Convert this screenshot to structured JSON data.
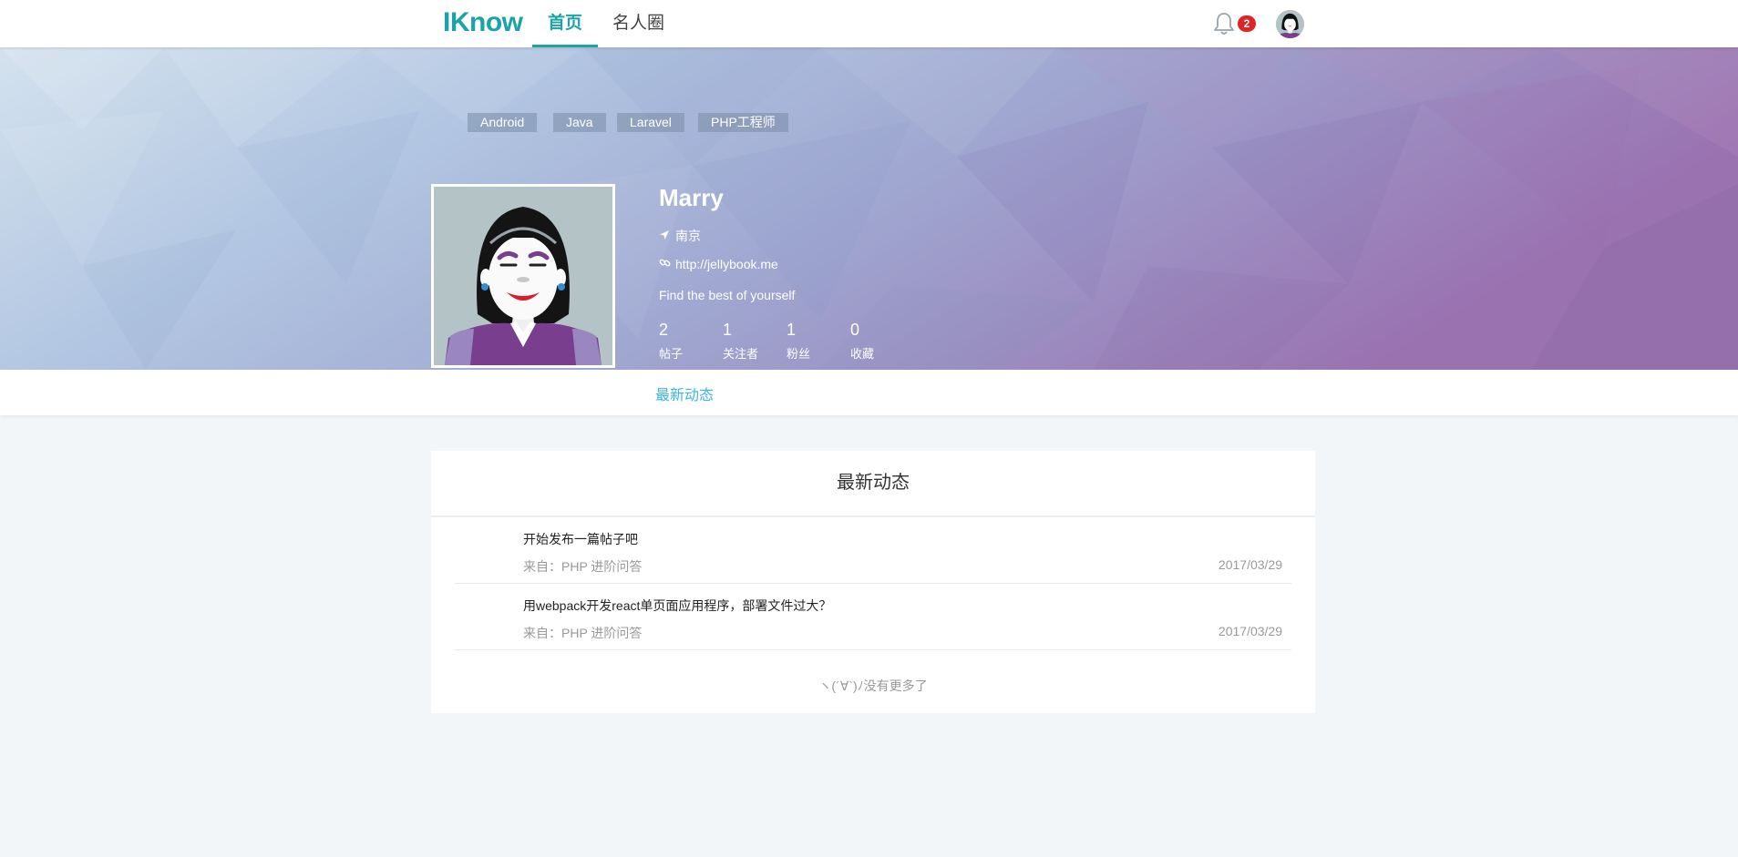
{
  "nav": {
    "logo": "IKnow",
    "tabs": [
      {
        "label": "首页",
        "active": true
      },
      {
        "label": "名人圈",
        "active": false
      }
    ],
    "notification_count": "2",
    "icons": {
      "bell": "bell-icon",
      "avatar": "user-avatar"
    }
  },
  "tags": [
    "Android",
    "Java",
    "Laravel",
    "PHP工程师"
  ],
  "profile": {
    "name": "Marry",
    "location": "南京",
    "website": "http://jellybook.me",
    "bio": "Find the best of yourself",
    "stats": [
      {
        "value": "2",
        "label": "帖子"
      },
      {
        "value": "1",
        "label": "关注者"
      },
      {
        "value": "1",
        "label": "粉丝"
      },
      {
        "value": "0",
        "label": "收藏"
      }
    ]
  },
  "subnav": {
    "active_tab": "最新动态"
  },
  "feed": {
    "title": "最新动态",
    "items": [
      {
        "title": "开始发布一篇帖子吧",
        "source": "来自：PHP 进阶问答",
        "date": "2017/03/29"
      },
      {
        "title": "用webpack开发react单页面应用程序，部署文件过大？",
        "source": "来自：PHP 进阶问答",
        "date": "2017/03/29"
      }
    ],
    "end_text": "ヽ(´∀`)ﾉ没有更多了"
  },
  "colors": {
    "brand": "#1aa3a8",
    "accent_link": "#3cb5e8",
    "badge": "#e02424"
  }
}
